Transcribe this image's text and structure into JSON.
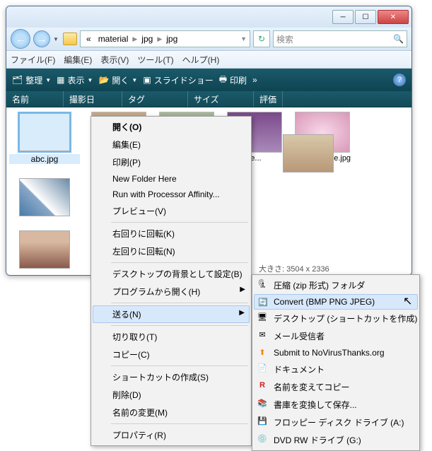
{
  "breadcrumb": {
    "lead": "«",
    "p1": "material",
    "p2": "jpg",
    "p3": "jpg"
  },
  "search": {
    "placeholder": "検索"
  },
  "menubar": {
    "file": "ファイル(F)",
    "edit": "編集(E)",
    "view": "表示(V)",
    "tools": "ツール(T)",
    "help": "ヘルプ(H)"
  },
  "toolbar": {
    "organize": "整理",
    "view": "表示",
    "open": "開く",
    "slideshow": "スライドショー",
    "print": "印刷",
    "more": "»"
  },
  "headers": {
    "name": "名前",
    "date": "撮影日",
    "tag": "タグ",
    "size": "サイズ",
    "rating": "評価"
  },
  "files": {
    "abc": "abc.jpg",
    "arke": "arke...",
    "beauty": "Beauty_tree.jpg"
  },
  "status": {
    "dim_label": "大きさ:",
    "dim_value": "3504 x 2336"
  },
  "ctx": {
    "open": "開く(O)",
    "edit": "編集(E)",
    "print": "印刷(P)",
    "newfolder": "New Folder Here",
    "affinity": "Run with Processor Affinity...",
    "preview": "プレビュー(V)",
    "rotr": "右回りに回転(K)",
    "rotl": "左回りに回転(N)",
    "wallpaper": "デスクトップの背景として設定(B)",
    "openwith": "プログラムから開く(H)",
    "sendto": "送る(N)",
    "cut": "切り取り(T)",
    "copy": "コピー(C)",
    "shortcut": "ショートカットの作成(S)",
    "delete": "削除(D)",
    "rename": "名前の変更(M)",
    "props": "プロパティ(R)"
  },
  "send": {
    "zip": "圧縮 (zip 形式) フォルダ",
    "convert": "Convert (BMP PNG JPEG)",
    "desktop": "デスクトップ (ショートカットを作成)",
    "mail": "メール受信者",
    "novirus": "Submit to NoVirusThanks.org",
    "docs": "ドキュメント",
    "renamecopy": "名前を変えてコピー",
    "convsave": "書庫を変換して保存...",
    "floppy": "フロッピー ディスク ドライブ (A:)",
    "dvdrw": "DVD RW ドライブ (G:)"
  }
}
